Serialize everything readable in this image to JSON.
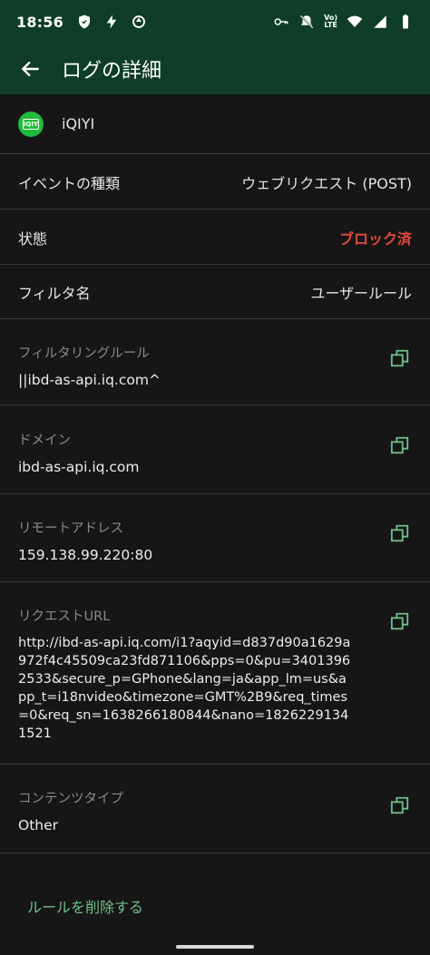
{
  "status_bar": {
    "time": "18:56",
    "left_icons": [
      "shield-icon",
      "bolt-icon",
      "sync-icon"
    ],
    "right_icons": [
      "key-icon",
      "mute-icon",
      "volte-icon",
      "wifi-icon",
      "signal-icon",
      "battery-icon"
    ],
    "volte_text_top": "Vo)",
    "volte_text_bottom": "LTE"
  },
  "app_bar": {
    "title": "ログの詳細",
    "back_icon": "arrow-left-icon"
  },
  "app": {
    "name": "iQIYI",
    "icon_text": "iQIY",
    "icon_color": "#1fbb3a"
  },
  "rows": {
    "event_type": {
      "label": "イベントの種類",
      "value": "ウェブリクエスト (POST)"
    },
    "status": {
      "label": "状態",
      "value": "ブロック済",
      "color": "#e14b3b"
    },
    "filter_name": {
      "label": "フィルタ名",
      "value": "ユーザールール"
    }
  },
  "details": {
    "filtering_rule": {
      "label": "フィルタリングルール",
      "value": "||ibd-as-api.iq.com^"
    },
    "domain": {
      "label": "ドメイン",
      "value": "ibd-as-api.iq.com"
    },
    "remote_address": {
      "label": "リモートアドレス",
      "value": "159.138.99.220:80"
    },
    "request_url": {
      "label": "リクエストURL",
      "value": "http://ibd-as-api.iq.com/i1?aqyid=d837d90a1629a972f4c45509ca23fd871106&pps=0&pu=34013962533&secure_p=GPhone&lang=ja&app_lm=us&app_t=i18nvideo&timezone=GMT%2B9&req_times=0&req_sn=1638266180844&nano=18262291341521"
    },
    "content_type": {
      "label": "コンテンツタイプ",
      "value": "Other"
    }
  },
  "actions": {
    "delete_rule": "ルールを削除する",
    "accent_color": "#6fbf87"
  }
}
